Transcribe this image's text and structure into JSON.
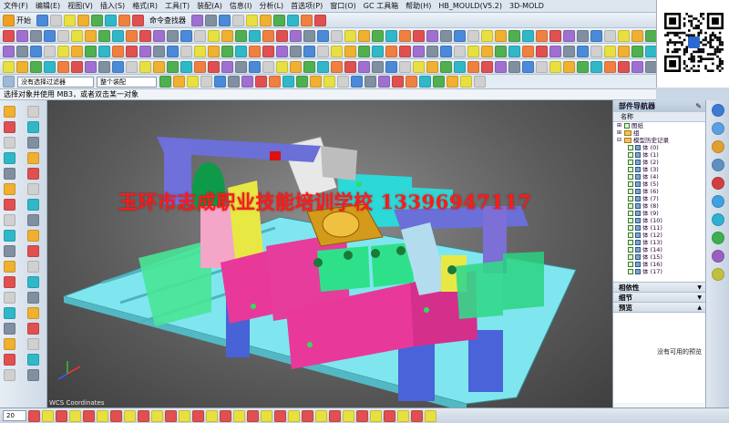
{
  "menu": {
    "items": [
      "文件(F)",
      "编辑(E)",
      "视图(V)",
      "插入(S)",
      "格式(R)",
      "工具(T)",
      "装配(A)",
      "信息(I)",
      "分析(L)",
      "首选项(P)",
      "窗口(O)",
      "GC 工具箱",
      "帮助(H)",
      "HB_MOULD(V5.2)",
      "3D-MOLD"
    ]
  },
  "toolbar": {
    "start_label": "开始",
    "command_finder_label": "命令查找器"
  },
  "selection_bar": {
    "filter_value": "没有选择过滤器",
    "scope_value": "整个装配"
  },
  "cue_line": "选择对象并使用 MB3，或者双击某一对象",
  "watermark": "玉环市志成职业技能培训学校 13396947117",
  "viewport_caption": "WCS Coordinates",
  "navigator": {
    "title": "部件导航器",
    "column_header": "名称",
    "root_items": [
      {
        "label": "图纸"
      },
      {
        "label": "组"
      },
      {
        "label": "模型历史记录"
      }
    ],
    "bodies": [
      "体 (0)",
      "体 (1)",
      "体 (2)",
      "体 (3)",
      "体 (4)",
      "体 (5)",
      "体 (6)",
      "体 (7)",
      "体 (8)",
      "体 (9)",
      "体 (10)",
      "体 (11)",
      "体 (12)",
      "体 (13)",
      "体 (14)",
      "体 (15)",
      "体 (16)",
      "体 (17)"
    ],
    "sections": {
      "dependencies": "相依性",
      "details": "细节",
      "preview": "预览"
    },
    "preview_message": "没有可用的预览"
  },
  "statusbar": {
    "zoom_value": "20"
  },
  "colors": {
    "cyan_base": "#7fe6ef",
    "magenta": "#e8399a",
    "blue_clamp": "#6b6fd8",
    "green": "#2fe08a",
    "yellow": "#e6e640",
    "gold": "#d49a1a",
    "watermark_red": "#ff1a1a"
  }
}
